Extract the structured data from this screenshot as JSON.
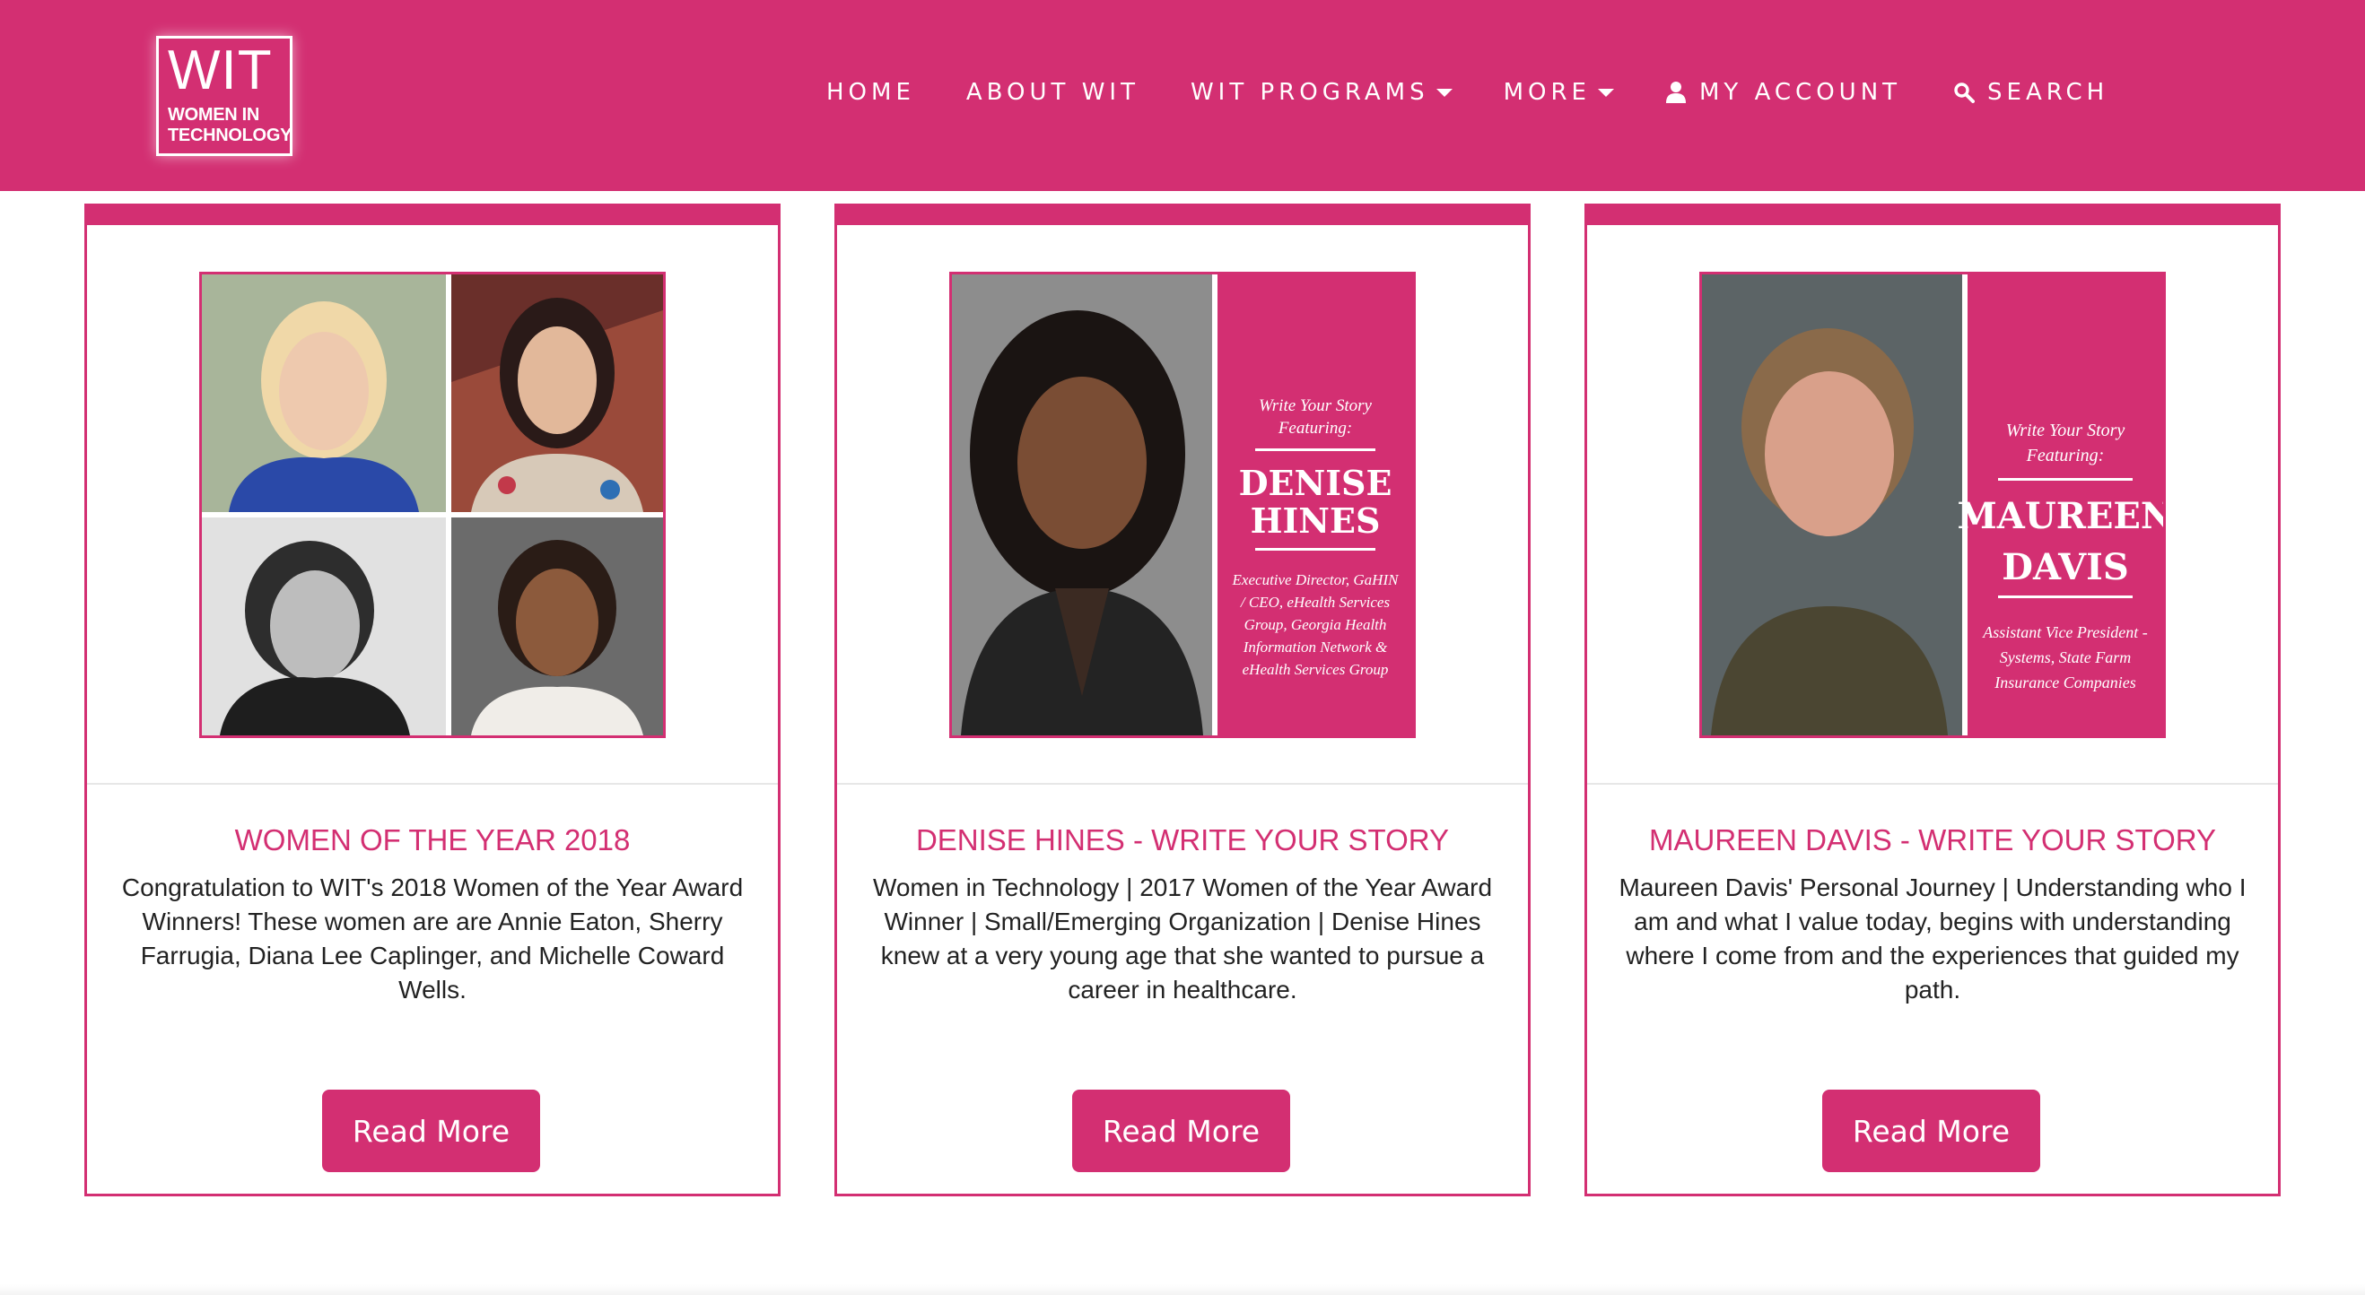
{
  "colors": {
    "brand": "#d32f72",
    "white": "#ffffff",
    "text": "#222222"
  },
  "logo": {
    "main": "WIT",
    "sub_line1": "WOMEN IN",
    "sub_line2": "TECHNOLOGY"
  },
  "nav": [
    {
      "label": "HOME"
    },
    {
      "label": "ABOUT WIT"
    },
    {
      "label": "WIT PROGRAMS",
      "icon": "chevron-down-icon"
    },
    {
      "label": "MORE",
      "icon": "chevron-down-icon"
    },
    {
      "label": "MY ACCOUNT",
      "icon": "user-icon"
    },
    {
      "label": "SEARCH",
      "icon": "search-icon"
    }
  ],
  "cards": [
    {
      "title": "WOMEN OF THE YEAR 2018",
      "text": "Congratulation to WIT's 2018 Women of the Year Award Winners! These women are are Annie Eaton, Sherry Farrugia, Diana Lee Caplinger, and Michelle Coward Wells.",
      "button": "Read More"
    },
    {
      "title": "DENISE HINES - WRITE YOUR STORY",
      "text": "Women in Technology | 2017 Women of the Year Award Winner | Small/Emerging Organization | Denise Hines knew at a very young age that she wanted to pursue a career in healthcare.",
      "button": "Read More",
      "image": {
        "heading_line1": "Write Your Story",
        "heading_line2": "Featuring:",
        "name_line1": "DENISE",
        "name_line2": "HINES",
        "role_lines": [
          "Executive Director, GaHIN",
          "/ CEO, eHealth Services",
          "Group, Georgia Health",
          "Information Network &",
          "eHealth Services Group"
        ]
      }
    },
    {
      "title": "MAUREEN DAVIS - WRITE YOUR STORY",
      "text": "Maureen Davis' Personal Journey | Understanding who I am and what I value today, begins with understanding where I come from and the experiences that guided my path.",
      "button": "Read More",
      "image": {
        "heading_line1": "Write Your Story",
        "heading_line2": "Featuring:",
        "name_line1": "MAUREEN",
        "name_line2": "DAVIS",
        "role_lines": [
          "Assistant Vice President -",
          "Systems, State Farm",
          "Insurance Companies"
        ]
      }
    }
  ]
}
